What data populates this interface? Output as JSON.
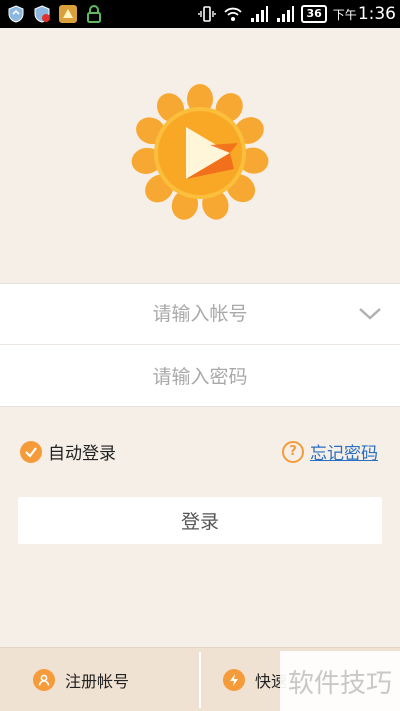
{
  "status_bar": {
    "battery": "36",
    "time_prefix": "下午",
    "time": "1:36",
    "icons": [
      "shield-icon",
      "shield-alert-icon",
      "app-icon",
      "lock-icon",
      "vibrate-icon",
      "wifi-icon",
      "signal-icon",
      "signal-icon"
    ]
  },
  "login": {
    "account_placeholder": "请输入帐号",
    "password_placeholder": "请输入密码",
    "auto_login_label": "自动登录",
    "forgot_password_label": "忘记密码",
    "submit_label": "登录"
  },
  "footer": {
    "register_label": "注册帐号",
    "quick_label": "快速"
  },
  "watermark": "软件技巧",
  "colors": {
    "accent": "#f59b3a",
    "link": "#2a6fc0",
    "background": "#f6efe8",
    "footer": "#f0e2d3"
  }
}
